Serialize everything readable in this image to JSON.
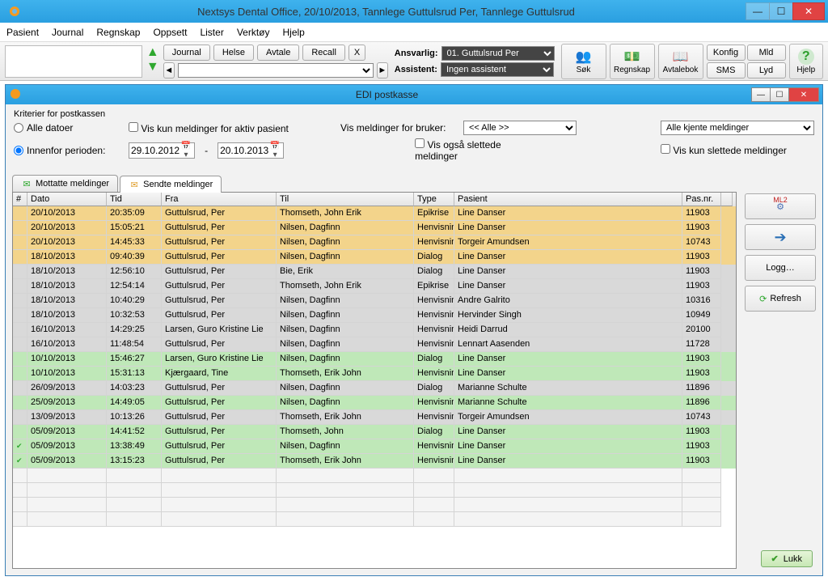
{
  "title": "Nextsys Dental Office,  20/10/2013, Tannlege Guttulsrud Per,  Tannlege Guttulsrud",
  "menubar": [
    "Pasient",
    "Journal",
    "Regnskap",
    "Oppsett",
    "Lister",
    "Verktøy",
    "Hjelp"
  ],
  "toolbar": {
    "journal": "Journal",
    "helse": "Helse",
    "avtale": "Avtale",
    "recall": "Recall",
    "x": "X",
    "ansvarlig_label": "Ansvarlig:",
    "ansvarlig_value": "01. Guttulsrud Per",
    "assistent_label": "Assistent:",
    "assistent_value": "Ingen assistent",
    "sok": "Søk",
    "regnskap_btn": "Regnskap",
    "avtalebok": "Avtalebok",
    "konfig": "Konfig",
    "mld": "Mld",
    "sms": "SMS",
    "lyd": "Lyd",
    "hjelp": "Hjelp"
  },
  "subwin": {
    "title": "EDI postkasse",
    "criteria_title": "Kriterier for postkassen",
    "all_dates": "Alle datoer",
    "within_period": "Innenfor perioden:",
    "from": "29.10.2012",
    "to": "20.10.2013",
    "only_active": "Vis kun meldinger for aktiv pasient",
    "for_user_label": "Vis meldinger for bruker:",
    "for_user_value": "<< Alle >>",
    "also_deleted": "Vis også slettede meldinger",
    "filter_value": "Alle kjente meldinger",
    "only_deleted": "Vis kun slettede meldinger",
    "tab_received": "Mottatte meldinger",
    "tab_sent": "Sendte meldinger",
    "btn_ml2": "ML2",
    "btn_logg": "Logg…",
    "btn_refresh": "Refresh",
    "btn_lukk": "Lukk"
  },
  "columns": [
    "#",
    "Dato",
    "Tid",
    "Fra",
    "Til",
    "Type",
    "Pasient",
    "Pas.nr."
  ],
  "rows": [
    {
      "c": "yellow",
      "dato": "20/10/2013",
      "tid": "20:35:09",
      "fra": "Guttulsrud, Per",
      "til": "Thomseth, John Erik",
      "type": "Epikrise",
      "pas": "Line Danser",
      "nr": "11903"
    },
    {
      "c": "yellow",
      "dato": "20/10/2013",
      "tid": "15:05:21",
      "fra": "Guttulsrud, Per",
      "til": "Nilsen, Dagfinn",
      "type": "Henvisnin",
      "pas": "Line Danser",
      "nr": "11903"
    },
    {
      "c": "yellow",
      "dato": "20/10/2013",
      "tid": "14:45:33",
      "fra": "Guttulsrud, Per",
      "til": "Nilsen, Dagfinn",
      "type": "Henvisnin",
      "pas": "Torgeir Amundsen",
      "nr": "10743"
    },
    {
      "c": "yellow",
      "dato": "18/10/2013",
      "tid": "09:40:39",
      "fra": "Guttulsrud, Per",
      "til": "Nilsen, Dagfinn",
      "type": "Dialog",
      "pas": "Line Danser",
      "nr": "11903"
    },
    {
      "c": "grey",
      "dato": "18/10/2013",
      "tid": "12:56:10",
      "fra": "Guttulsrud, Per",
      "til": "Bie, Erik",
      "type": "Dialog",
      "pas": "Line Danser",
      "nr": "11903"
    },
    {
      "c": "grey",
      "dato": "18/10/2013",
      "tid": "12:54:14",
      "fra": "Guttulsrud, Per",
      "til": "Thomseth, John Erik",
      "type": "Epikrise",
      "pas": "Line Danser",
      "nr": "11903"
    },
    {
      "c": "grey",
      "dato": "18/10/2013",
      "tid": "10:40:29",
      "fra": "Guttulsrud, Per",
      "til": "Nilsen, Dagfinn",
      "type": "Henvisnin",
      "pas": "Andre Galrito",
      "nr": "10316"
    },
    {
      "c": "grey",
      "dato": "18/10/2013",
      "tid": "10:32:53",
      "fra": "Guttulsrud, Per",
      "til": "Nilsen, Dagfinn",
      "type": "Henvisnin",
      "pas": "Hervinder Singh",
      "nr": "10949"
    },
    {
      "c": "grey",
      "dato": "16/10/2013",
      "tid": "14:29:25",
      "fra": "Larsen, Guro Kristine Lie",
      "til": "Nilsen, Dagfinn",
      "type": "Henvisnin",
      "pas": "Heidi Darrud",
      "nr": "20100"
    },
    {
      "c": "grey",
      "dato": "16/10/2013",
      "tid": "11:48:54",
      "fra": "Guttulsrud, Per",
      "til": "Nilsen, Dagfinn",
      "type": "Henvisnin",
      "pas": "Lennart Aasenden",
      "nr": "11728"
    },
    {
      "c": "green",
      "dato": "10/10/2013",
      "tid": "15:46:27",
      "fra": "Larsen, Guro Kristine Lie",
      "til": "Nilsen, Dagfinn",
      "type": "Dialog",
      "pas": "Line Danser",
      "nr": "11903"
    },
    {
      "c": "green",
      "dato": "10/10/2013",
      "tid": "15:31:13",
      "fra": "Kjærgaard, Tine",
      "til": "Thomseth, Erik John",
      "type": "Henvisnin",
      "pas": "Line Danser",
      "nr": "11903"
    },
    {
      "c": "grey",
      "dato": "26/09/2013",
      "tid": "14:03:23",
      "fra": "Guttulsrud, Per",
      "til": "Nilsen, Dagfinn",
      "type": "Dialog",
      "pas": "Marianne Schulte",
      "nr": "11896"
    },
    {
      "c": "green",
      "dato": "25/09/2013",
      "tid": "14:49:05",
      "fra": "Guttulsrud, Per",
      "til": "Nilsen, Dagfinn",
      "type": "Henvisnin",
      "pas": "Marianne Schulte",
      "nr": "11896"
    },
    {
      "c": "grey",
      "dato": "13/09/2013",
      "tid": "10:13:26",
      "fra": "Guttulsrud, Per",
      "til": "Thomseth, Erik John",
      "type": "Henvisnin",
      "pas": "Torgeir Amundsen",
      "nr": "10743"
    },
    {
      "c": "green",
      "dato": "05/09/2013",
      "tid": "14:41:52",
      "fra": "Guttulsrud, Per",
      "til": "Thomseth, John",
      "type": "Dialog",
      "pas": "Line Danser",
      "nr": "11903"
    },
    {
      "c": "green",
      "mark": true,
      "dato": "05/09/2013",
      "tid": "13:38:49",
      "fra": "Guttulsrud, Per",
      "til": "Nilsen, Dagfinn",
      "type": "Henvisnin",
      "pas": "Line Danser",
      "nr": "11903"
    },
    {
      "c": "green",
      "mark": true,
      "dato": "05/09/2013",
      "tid": "13:15:23",
      "fra": "Guttulsrud, Per",
      "til": "Thomseth, Erik John",
      "type": "Henvisnin",
      "pas": "Line Danser",
      "nr": "11903"
    }
  ]
}
